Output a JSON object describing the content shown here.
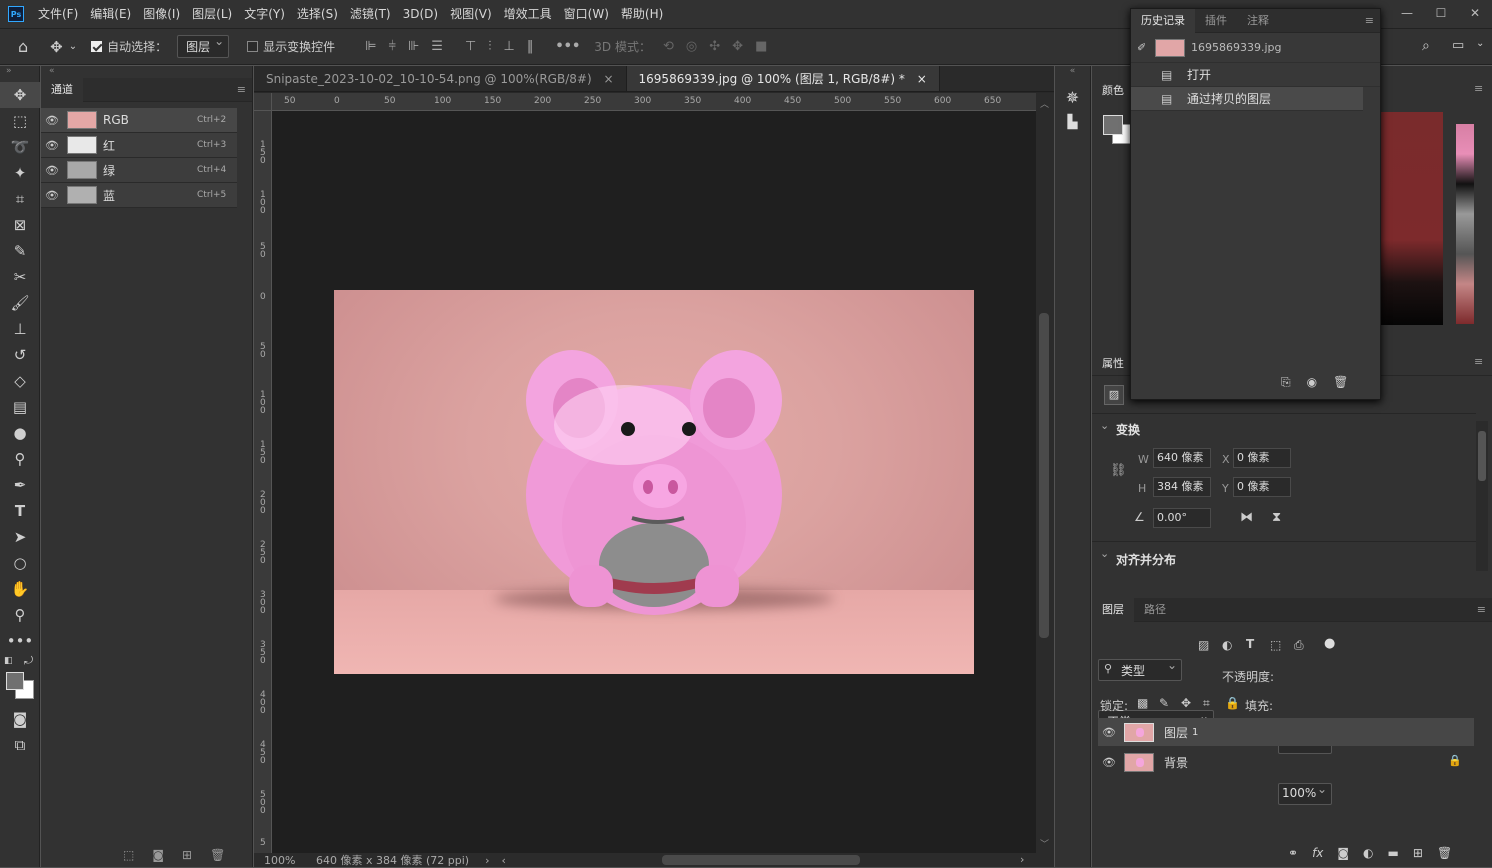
{
  "app": {
    "logo": "Ps"
  },
  "menu": [
    "文件(F)",
    "编辑(E)",
    "图像(I)",
    "图层(L)",
    "文字(Y)",
    "选择(S)",
    "滤镜(T)",
    "3D(D)",
    "视图(V)",
    "增效工具",
    "窗口(W)",
    "帮助(H)"
  ],
  "options": {
    "auto_select_label": "自动选择：",
    "auto_select_value": "图层",
    "show_transform_label": "显示变换控件",
    "mode_3d_label": "3D 模式："
  },
  "doc_tabs": [
    {
      "label": "Snipaste_2023-10-02_10-10-54.png @ 100%(RGB/8#)",
      "close": "×"
    },
    {
      "label": "1695869339.jpg @ 100% (图层 1, RGB/8#) *",
      "close": "×"
    }
  ],
  "ruler_h": [
    "50",
    "0",
    "50",
    "100",
    "150",
    "200",
    "250",
    "300",
    "350",
    "400",
    "450",
    "500",
    "550",
    "600",
    "650"
  ],
  "ruler_v": [
    "1\n5\n0",
    "1\n0\n0",
    "5\n0",
    "0",
    "5\n0",
    "1\n0\n0",
    "1\n5\n0",
    "2\n0\n0",
    "2\n5\n0",
    "3\n0\n0",
    "3\n5\n0",
    "4\n0\n0",
    "4\n5\n0",
    "5\n0\n0",
    "5"
  ],
  "status": {
    "zoom": "100%",
    "size": "640 像素 x 384 像素 (72 ppi)"
  },
  "channels": {
    "tab": "通道",
    "rows": [
      {
        "name": "RGB",
        "key": "Ctrl+2"
      },
      {
        "name": "红",
        "key": "Ctrl+3"
      },
      {
        "name": "绿",
        "key": "Ctrl+4"
      },
      {
        "name": "蓝",
        "key": "Ctrl+5"
      }
    ]
  },
  "history": {
    "tabs": [
      "历史记录",
      "插件",
      "注释"
    ],
    "snapshot": "1695869339.jpg",
    "steps": [
      "打开",
      "通过拷贝的图层"
    ]
  },
  "color_tab": "颜色",
  "props_tab": "属性",
  "transform": {
    "title": "变换",
    "w_label": "W",
    "w": "640 像素",
    "x_label": "X",
    "x": "0 像素",
    "h_label": "H",
    "h": "384 像素",
    "y_label": "Y",
    "y": "0 像素",
    "angle": "0.00°",
    "align_title": "对齐并分布"
  },
  "layers": {
    "tabs": [
      "图层",
      "路径"
    ],
    "filter": "类型",
    "blend": "正常",
    "opacity_label": "不透明度:",
    "opacity": "100%",
    "lock_label": "锁定:",
    "fill_label": "填充:",
    "fill": "100%",
    "items": [
      {
        "name": "图层",
        "num": "1"
      },
      {
        "name": "背景",
        "num": ""
      }
    ]
  }
}
